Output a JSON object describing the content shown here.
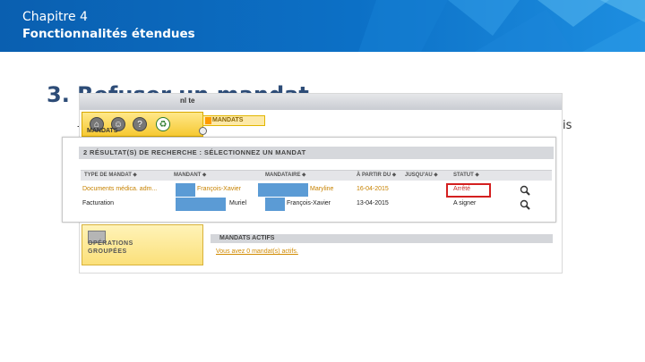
{
  "header": {
    "chapter_label": "Chapitre 4",
    "chapter_title": "Fonctionnalités étendues"
  },
  "slide": {
    "heading": "3. Refuser un mandat",
    "bullet_fragment": "-",
    "trailing_fragment": "is"
  },
  "app": {
    "topbar_title": "nl te",
    "toolbar_icons": [
      "home-icon",
      "users-icon",
      "help-icon",
      "recycle-icon"
    ],
    "mandats_tab": "MANDATS",
    "mandats_menu": "MANDATS",
    "ops_label_line1": "OPÉRATIONS",
    "ops_label_line2": "GROUPÉES",
    "actifs_header": "MANDATS ACTIFS",
    "actifs_link": "Vous avez 0 mandat(s) actifs."
  },
  "results": {
    "header": "2 RÉSULTAT(S) DE RECHERCHE : SÉLECTIONNEZ UN MANDAT",
    "columns": [
      "TYPE DE MANDAT ⬥",
      "MANDANT ⬥",
      "MANDATAIRE ⬥",
      "À PARTIR DU ⬥",
      "JUSQU'AU ⬥",
      "STATUT ⬥"
    ],
    "rows": [
      {
        "type": "Documents médica. adm...",
        "mandant": "François-Xavier",
        "mandataire": "Maryline",
        "from": "16-04-2015",
        "until": "",
        "status": "Arrêté"
      },
      {
        "type": "Facturation",
        "mandant": "Muriel",
        "mandataire": "François-Xavier",
        "from": "13-04-2015",
        "until": "",
        "status": "A signer"
      }
    ]
  },
  "colors": {
    "header_blue": "#0c70c6",
    "heading_navy": "#2d4c77",
    "toolbar_yellow": "#f6c932",
    "highlight_red": "#d42020",
    "redaction_blue": "#5b9bd5",
    "link_orange": "#c78200"
  }
}
